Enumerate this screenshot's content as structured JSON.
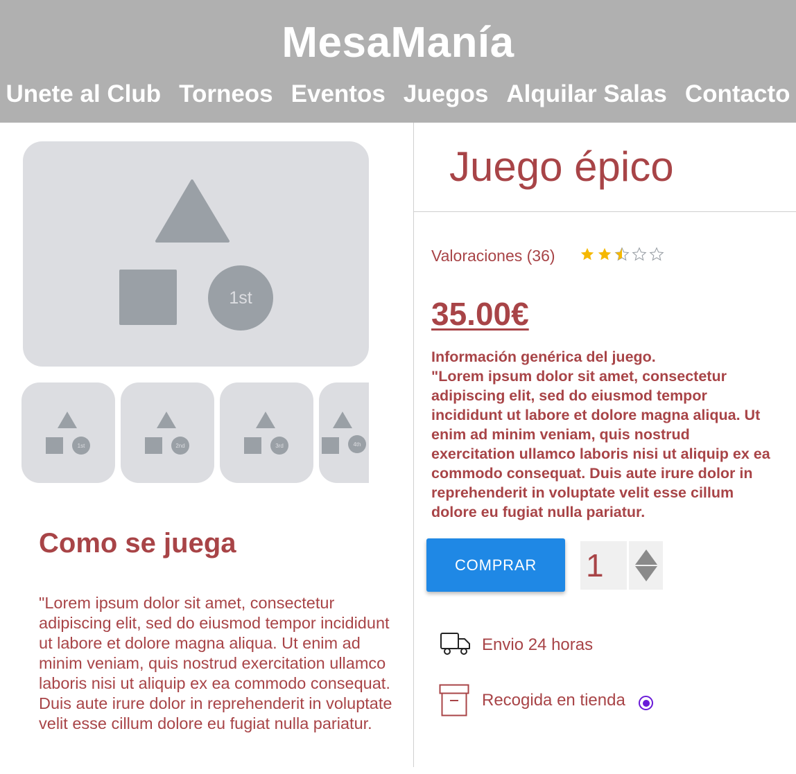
{
  "header": {
    "brand": "MesaManía",
    "nav": [
      "Unete al Club",
      "Torneos",
      "Eventos",
      "Juegos",
      "Alquilar Salas",
      "Contacto"
    ]
  },
  "gallery": {
    "main_badge": "1st",
    "thumbnails": [
      "1st",
      "2nd",
      "3rd",
      "4th"
    ]
  },
  "how_to_play": {
    "title": "Como se juega",
    "text": "\"Lorem ipsum dolor sit amet, consectetur adipiscing elit, sed do eiusmod tempor incididunt ut labore et dolore magna aliqua. Ut enim ad minim veniam, quis nostrud exercitation ullamco laboris nisi ut aliquip ex ea commodo consequat. Duis aute irure dolor in reprehenderit in voluptate velit esse cillum dolore eu fugiat nulla pariatur."
  },
  "product": {
    "title": "Juego épico",
    "ratings_label": "Valoraciones (36)",
    "rating": 2.5,
    "rating_max": 5,
    "price": "35.00€",
    "info_heading": "Información genérica del juego.",
    "info_text": "\"Lorem ipsum dolor sit amet, consectetur adipiscing elit, sed do eiusmod tempor incididunt ut labore et dolore magna aliqua. Ut enim ad minim veniam, quis nostrud exercitation ullamco laboris nisi ut aliquip ex ea commodo consequat. Duis aute irure dolor in reprehenderit in voluptate velit esse cillum dolore eu fugiat nulla pariatur.",
    "buy_label": "COMPRAR",
    "quantity": "1",
    "shipping_label": "Envio 24 horas",
    "pickup_label": "Recogida en tienda"
  },
  "colors": {
    "header_bg": "#b0b0b0",
    "accent_text": "#a84447",
    "buy_button": "#1f88e5",
    "star_filled": "#f5b800",
    "radio": "#6a1bd8",
    "placeholder_bg": "#dcdde1",
    "placeholder_shape": "#9aa0a6"
  },
  "icons": {
    "star": "star-icon",
    "shipping": "truck-icon",
    "pickup": "box-icon",
    "quantity_up": "triangle-up-icon",
    "quantity_down": "triangle-down-icon"
  }
}
